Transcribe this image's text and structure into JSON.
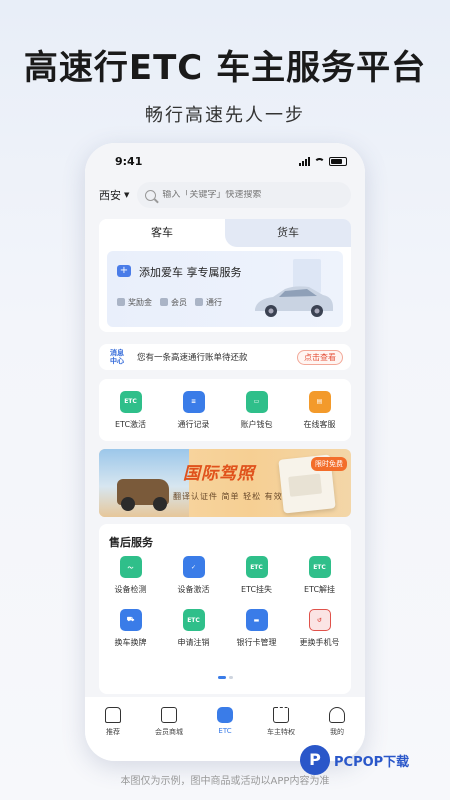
{
  "headline": "高速行ETC  车主服务平台",
  "subline": "畅行高速先人一步",
  "status": {
    "time": "9:41"
  },
  "topbar": {
    "city": "西安",
    "search_placeholder": "输入「关键字」快速搜索"
  },
  "tabs": [
    {
      "label": "客车"
    },
    {
      "label": "货车"
    }
  ],
  "promo": {
    "title": "添加爱车  享专属服务",
    "tags": [
      "奖励金",
      "会员",
      "通行"
    ]
  },
  "message": {
    "badge_line1": "消息",
    "badge_line2": "中心",
    "text": "您有一条高速通行账单待还款",
    "button": "点击查看"
  },
  "quick_actions": [
    {
      "label": "ETC激活",
      "icon": "etc-activate-icon",
      "color": "#2fbf8a"
    },
    {
      "label": "通行记录",
      "icon": "document-icon",
      "color": "#3a7ce8"
    },
    {
      "label": "账户钱包",
      "icon": "wallet-icon",
      "color": "#2fbf8a"
    },
    {
      "label": "在线客服",
      "icon": "chat-icon",
      "color": "#f39a2b"
    }
  ],
  "banner": {
    "title": "国际驾照",
    "subtitle": "翻译认证件 简单 轻松 有效",
    "badge": "限时免费"
  },
  "after_sales": {
    "title": "售后服务",
    "items": [
      {
        "label": "设备检测"
      },
      {
        "label": "设备激活"
      },
      {
        "label": "ETC挂失"
      },
      {
        "label": "ETC解挂"
      },
      {
        "label": "换车换牌"
      },
      {
        "label": "申请注销"
      },
      {
        "label": "银行卡管理"
      },
      {
        "label": "更换手机号"
      }
    ]
  },
  "nav": [
    {
      "label": "推荐"
    },
    {
      "label": "会员商城"
    },
    {
      "label": "ETC"
    },
    {
      "label": "车主特权"
    },
    {
      "label": "我的"
    }
  ],
  "footer_note": "本图仅为示例，图中商品或活动以APP内容为准",
  "watermark": {
    "logo": "P",
    "text": "PCPOP下载"
  },
  "icon_text": {
    "etc": "ETC"
  }
}
